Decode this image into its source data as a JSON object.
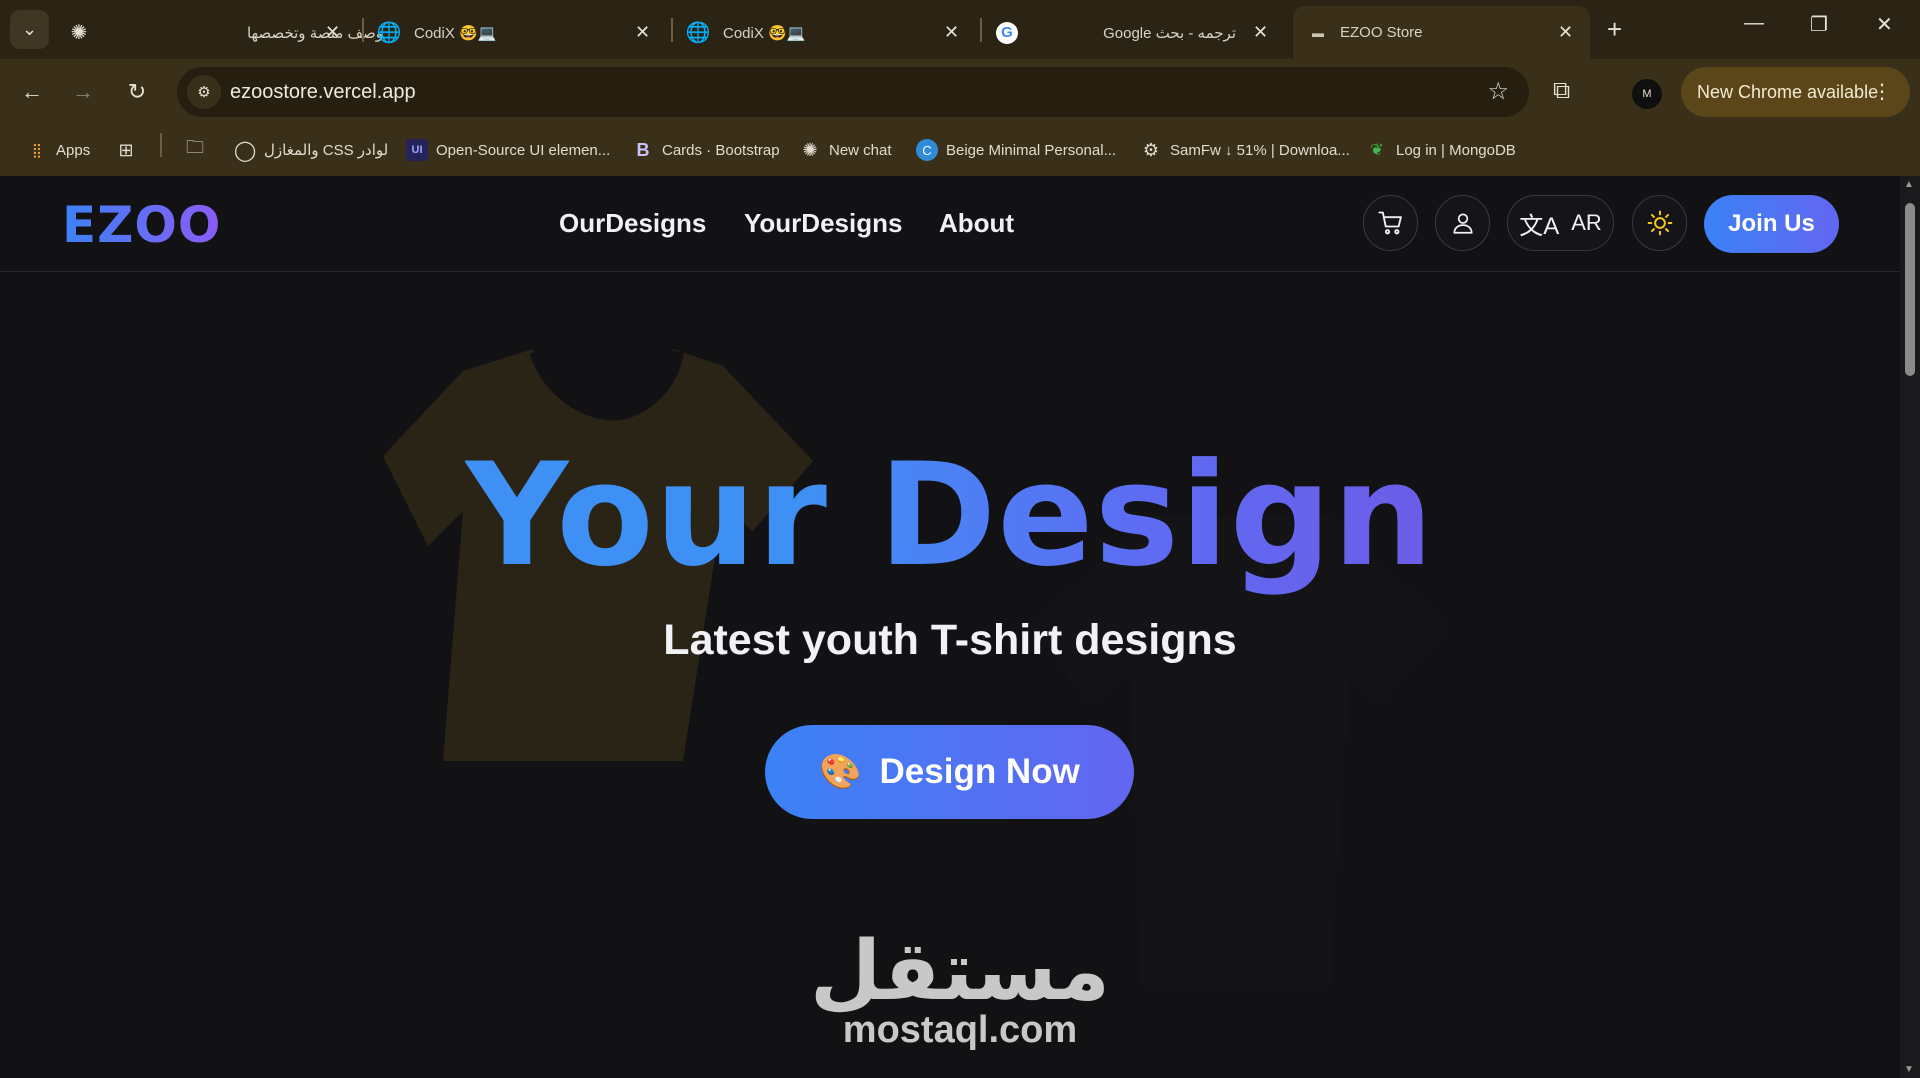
{
  "browser": {
    "tabs": [
      {
        "title": "وصف منصة وتخصصها",
        "favicon": "chatgpt-icon"
      },
      {
        "title": "CodiX 🤓💻",
        "favicon": "globe-icon"
      },
      {
        "title": "CodiX 🤓💻",
        "favicon": "globe-icon"
      },
      {
        "title": "ترجمه - بحث Google",
        "favicon": "google-icon"
      },
      {
        "title": "EZOO Store",
        "favicon": "ezoo-icon",
        "active": true
      }
    ],
    "url": "ezoostore.vercel.app",
    "update_label": "New Chrome available",
    "bookmarks": [
      {
        "label": "Apps",
        "icon": "apps-grid-icon"
      },
      {
        "label": "",
        "icon": "tab-groups-icon"
      },
      {
        "label": "",
        "icon": "folder-icon"
      },
      {
        "label": "لوادر CSS والمغازل",
        "icon": "spinner-icon"
      },
      {
        "label": "Open-Source UI elemen...",
        "icon": "ui-icon"
      },
      {
        "label": "Cards · Bootstrap",
        "icon": "bootstrap-icon"
      },
      {
        "label": "New chat",
        "icon": "chatgpt-icon"
      },
      {
        "label": "Beige Minimal Personal...",
        "icon": "canva-icon"
      },
      {
        "label": "SamFw ↓ 51% | Downloa...",
        "icon": "samfw-icon"
      },
      {
        "label": "Log in | MongoDB",
        "icon": "mongodb-icon"
      }
    ]
  },
  "site": {
    "logo": "EZOO",
    "nav": [
      "OurDesigns",
      "YourDesigns",
      "About"
    ],
    "lang_label": "AR",
    "join_label": "Join Us",
    "hero_title": "Your Design",
    "hero_subtitle": "Latest youth T-shirt designs",
    "cta_label": "Design Now"
  },
  "watermark": {
    "arabic": "مستقل",
    "latin": "mostaql.com"
  },
  "colors": {
    "accent_start": "#3b82f6",
    "accent_end": "#6366f1",
    "chrome_frame": "#3a3019",
    "page_bg": "#121114"
  }
}
